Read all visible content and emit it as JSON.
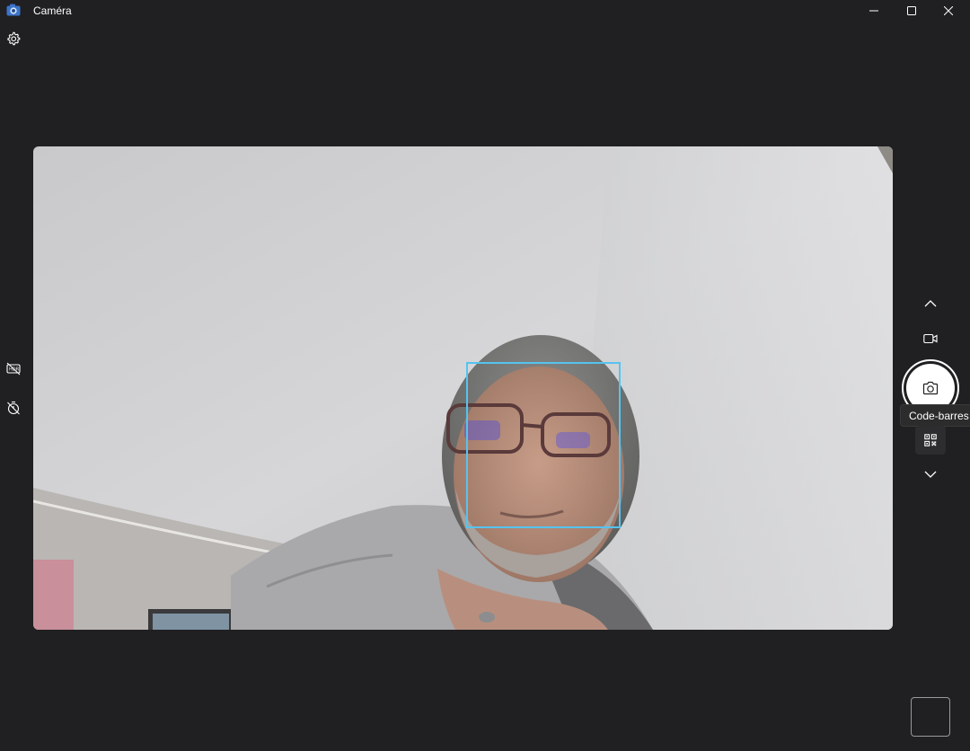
{
  "window": {
    "title": "Caméra",
    "icons": {
      "app": "camera-app-icon",
      "minimize": "minimize-icon",
      "maximize": "maximize-icon",
      "close": "close-icon"
    }
  },
  "toolbar": {
    "settings_icon": "gear-icon"
  },
  "left_controls": [
    {
      "name": "hdr-off-button",
      "icon": "hdr-off-icon"
    },
    {
      "name": "timer-off-button",
      "icon": "timer-off-icon"
    }
  ],
  "mode_controls": {
    "up_icon": "chevron-up-icon",
    "video_icon": "video-camera-icon",
    "photo_icon": "camera-icon",
    "barcode_icon": "qr-code-icon",
    "down_icon": "chevron-down-icon",
    "tooltip": "Code-barres"
  },
  "viewfinder": {
    "face_detection_box": true,
    "face_box_color": "#55c3f0"
  },
  "gallery": {
    "thumbnail_icon": "gallery-thumbnail"
  },
  "colors": {
    "background": "#201f21",
    "accent_face_box": "#55c3f0",
    "shutter": "#ffffff"
  }
}
